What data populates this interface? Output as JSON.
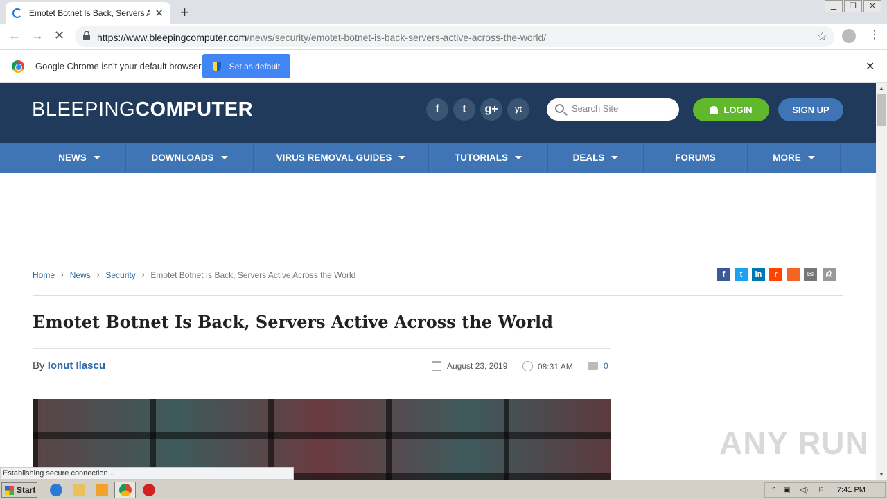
{
  "browser": {
    "tab_title": "Emotet Botnet Is Back, Servers Active Across the World",
    "url_host": "https://www.bleepingcomputer.com",
    "url_path": "/news/security/emotet-botnet-is-back-servers-active-across-the-world/",
    "infobar_message": "Google Chrome isn't your default browser",
    "infobar_button": "Set as default",
    "status": "Establishing secure connection..."
  },
  "site": {
    "logo_light": "BLEEPING",
    "logo_bold": "COMPUTER",
    "social": [
      "f",
      "t",
      "g+",
      "yt"
    ],
    "search_placeholder": "Search Site",
    "login_label": "LOGIN",
    "signup_label": "SIGN UP",
    "nav": [
      {
        "label": "NEWS",
        "dropdown": true
      },
      {
        "label": "DOWNLOADS",
        "dropdown": true
      },
      {
        "label": "VIRUS REMOVAL GUIDES",
        "dropdown": true
      },
      {
        "label": "TUTORIALS",
        "dropdown": true
      },
      {
        "label": "DEALS",
        "dropdown": true
      },
      {
        "label": "FORUMS",
        "dropdown": false
      },
      {
        "label": "MORE",
        "dropdown": true
      }
    ]
  },
  "breadcrumb": {
    "home": "Home",
    "news": "News",
    "security": "Security",
    "current": "Emotet Botnet Is Back, Servers Active Across the World"
  },
  "share_icons": [
    "facebook-icon",
    "twitter-icon",
    "linkedin-icon",
    "reddit-icon",
    "rss-icon",
    "email-icon",
    "print-icon"
  ],
  "article": {
    "title": "Emotet Botnet Is Back, Servers Active Across the World",
    "by": "By",
    "author": "Ionut Ilascu",
    "date": "August 23, 2019",
    "time": "08:31 AM",
    "comments": "0"
  },
  "watermark": "ANY RUN",
  "taskbar": {
    "start": "Start",
    "clock": "7:41 PM"
  },
  "colors": {
    "header_bg": "#1f3a5b",
    "nav_bg": "#3f74b5",
    "login_green": "#61b82c",
    "link_blue": "#2d6aa8"
  }
}
